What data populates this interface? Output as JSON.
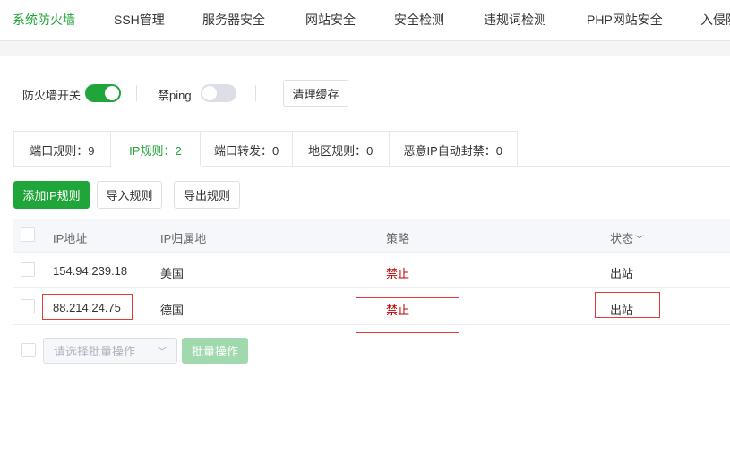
{
  "nav": {
    "tabs": [
      "系统防火墙",
      "SSH管理",
      "服务器安全",
      "网站安全",
      "安全检测",
      "违规词检测",
      "PHP网站安全",
      "入侵防"
    ]
  },
  "toolbar": {
    "firewall_switch_label": "防火墙开关",
    "firewall_switch_on": true,
    "ban_ping_label": "禁ping",
    "ban_ping_on": false,
    "clear_cache_label": "清理缓存"
  },
  "subtabs": [
    {
      "label": "端口规则：9"
    },
    {
      "label": "IP规则：2"
    },
    {
      "label": "端口转发：0"
    },
    {
      "label": "地区规则：0"
    },
    {
      "label": "恶意IP自动封禁：0"
    }
  ],
  "actions": {
    "add_ip_rule": "添加IP规则",
    "import_rules": "导入规则",
    "export_rules": "导出规则"
  },
  "table": {
    "headers": {
      "ip": "IP地址",
      "location": "IP归属地",
      "policy": "策略",
      "status": "状态"
    },
    "rows": [
      {
        "ip": "154.94.239.18",
        "location": "美国",
        "policy": "禁止",
        "status": "出站"
      },
      {
        "ip": "88.214.24.75",
        "location": "德国",
        "policy": "禁止",
        "status": "出站"
      }
    ]
  },
  "batch": {
    "select_placeholder": "请选择批量操作",
    "batch_button": "批量操作"
  },
  "colors": {
    "accent": "#20a53a",
    "deny": "#c00000",
    "highlight_box": "#e53935"
  }
}
